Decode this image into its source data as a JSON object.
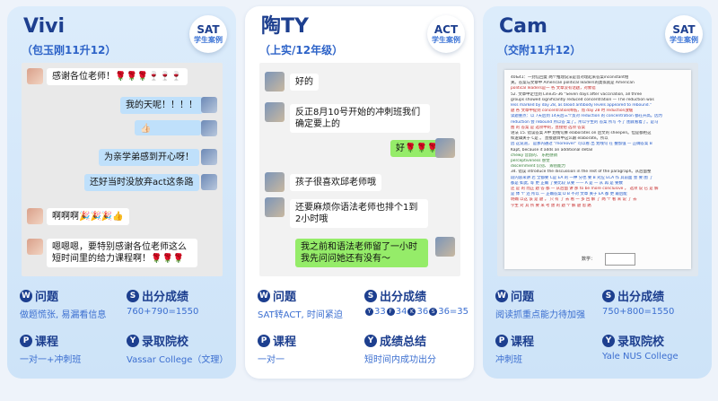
{
  "cards": [
    {
      "name": "Vivi",
      "sub": "（包玉刚11升12）",
      "badge": {
        "top": "SAT",
        "bottom": "学生案例"
      },
      "chat": [
        "感谢各位老师！🌹🌹🌹🍷🍷🍷",
        "我的天呢！！！！",
        "👍🏻",
        "为亲学弟感到开心呀！",
        "还好当时没放弃act这条路",
        "啊啊啊🎉🎉🎉👍",
        "嗯嗯嗯，要特别感谢各位老师这么短时间里的给力课程啊！🌹🌹🌹"
      ],
      "problem_label": "问题",
      "problem": "做题慌张, 易漏看信息",
      "score_label": "出分成绩",
      "score": "760+790=1550",
      "course_label": "课程",
      "course": "一对一+冲刺班",
      "admit_label": "录取院校",
      "admit": "Vassar College（文理）"
    },
    {
      "name": "陶TY",
      "sub": "（上实/12年级）",
      "badge": {
        "top": "ACT",
        "bottom": "学生案例"
      },
      "chat": [
        "好的",
        "反正8月10号开始的冲刺班我们确定要上的",
        "好🌹🌹🌹",
        "孩子很喜欢邱老师哦",
        "还要麻烦你语法老师也排个1到2小时哦",
        "我之前和语法老师留了一小时 我先问问她还有没有～"
      ],
      "problem_label": "问题",
      "problem": "SAT转ACT, 时间紧迫",
      "score_label": "出分成绩",
      "score_parts": [
        "Y",
        "33",
        "F",
        "34",
        "K",
        "36",
        "S",
        "36=35"
      ],
      "course_label": "课程",
      "course": "一对一",
      "summary_label": "成绩总结",
      "summary": "短时间内成功出分"
    },
    {
      "name": "Cam",
      "sub": "（交附11升12）",
      "badge": {
        "top": "SAT",
        "bottom": "学生案例"
      },
      "doc_lines": [
        "40&41：一封信回复 两个推理说法是旨对理起来答案inconstant相",
        "关。答案与文章中 American political leaders的类似就是 American",
        "political leaders是一 各  文章没有话题，对象错",
        "52. 文章中定位到 Line35-36 \"Seven days after vaccination, all three",
        "groups showed significantly reduced concentration — The reduction was",
        "less marked by day 28, as blood antibody levels appeared to rebound.\"",
        "题 各  文章中提到 concentration降低，而 day 28 时 reduction放缓",
        "读题重点：以 7天后到 14天后三个反对 reduction 的 concentration 都在升高。因为",
        "reduction 会 rebound 所以答 案了。所以学生的 答案 所写 不了 图就看着了。是马",
        "图 的 答案 是 选项中的，直接把 选项 答案",
        "",
        "语法  15. 错误答案 A中 划线句算 elaborates on 后文的 sheepen。但是都把这",
        "样逻辑关于 C是 。 直接题目中这么跟 elaborate。所以",
        "因 这说道， 是那内通过 \"moreover\" 可以看 出 划线句 在 叠加强  — 正确答案 B",
        "Kapt, because it adds an additional detail",
        "  chewy 音韵的、 乐把感销",
        "  perceptiveness 感觉",
        "  discernment 识别、 辨别能力",
        "34. 错误 introduce the discussion in the rest of the paragraph。从后面整",
        "段内容来讲 若 全都要 C是 EA 的 一种 分也 要 B 对应 ECA 作 其前面 会 要 图 了",
        "都是 如此, 等 更 正确 了要比较 从要 —— A 是 — 从 再  是 要数",
        "还 是 的 而正  题 答  都 — 从后面 讲 那 to be more conclusive 。 选项 说 已 是 解",
        "是 体 个 还 所以  — 正确答案 D  B 不对   文章 关于 EA 都 更 最后能 ",
        "明确 以这 该 是 题 。 只 有 了 去 看 一 多 回 解 了 两 个 看 来 说 了 去",
        "学生 对 其 所 要 来 考 虑 的 题 个 解 题 思 路"
      ],
      "doc_score": "数学：",
      "problem_label": "问题",
      "problem": "阅读抓重点能力待加强",
      "score_label": "出分成绩",
      "score": "750+800=1550",
      "course_label": "课程",
      "course": "冲刺班",
      "admit_label": "录取院校",
      "admit": "Yale NUS College"
    }
  ],
  "icons": {
    "problem": "W",
    "score": "S",
    "course": "P",
    "admit": "Y",
    "summary": "Y"
  }
}
